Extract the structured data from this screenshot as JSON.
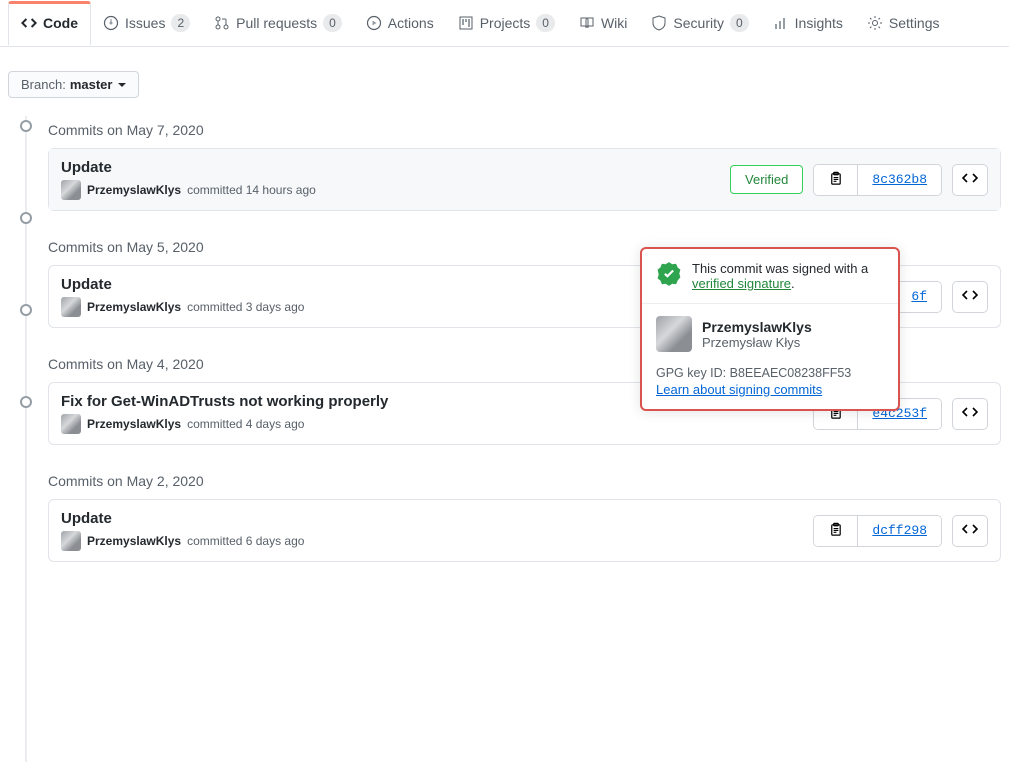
{
  "tabs": [
    {
      "label": "Code",
      "count": null,
      "selected": true,
      "name": "tab-code",
      "icon": "code-icon"
    },
    {
      "label": "Issues",
      "count": "2",
      "selected": false,
      "name": "tab-issues",
      "icon": "issue-icon"
    },
    {
      "label": "Pull requests",
      "count": "0",
      "selected": false,
      "name": "tab-pulls",
      "icon": "pull-request-icon"
    },
    {
      "label": "Actions",
      "count": null,
      "selected": false,
      "name": "tab-actions",
      "icon": "play-icon"
    },
    {
      "label": "Projects",
      "count": "0",
      "selected": false,
      "name": "tab-projects",
      "icon": "project-icon"
    },
    {
      "label": "Wiki",
      "count": null,
      "selected": false,
      "name": "tab-wiki",
      "icon": "book-icon"
    },
    {
      "label": "Security",
      "count": "0",
      "selected": false,
      "name": "tab-security",
      "icon": "shield-icon"
    },
    {
      "label": "Insights",
      "count": null,
      "selected": false,
      "name": "tab-insights",
      "icon": "graph-icon"
    },
    {
      "label": "Settings",
      "count": null,
      "selected": false,
      "name": "tab-settings",
      "icon": "gear-icon"
    }
  ],
  "branch": {
    "label": "Branch:",
    "name": "master"
  },
  "groups": [
    {
      "title": "Commits on May 7, 2020",
      "commits": [
        {
          "title": "Update",
          "author": "PrzemyslawKlys",
          "when": "committed 14 hours ago",
          "sha": "8c362b8",
          "verified": true,
          "highlight": true
        }
      ]
    },
    {
      "title": "Commits on May 5, 2020",
      "commits": [
        {
          "title": "Update",
          "author": "PrzemyslawKlys",
          "when": "committed 3 days ago",
          "sha": "6f",
          "verified": false,
          "highlight": false
        }
      ]
    },
    {
      "title": "Commits on May 4, 2020",
      "commits": [
        {
          "title": "Fix for Get-WinADTrusts not working properly",
          "author": "PrzemyslawKlys",
          "when": "committed 4 days ago",
          "sha": "e4c253f",
          "verified": false,
          "highlight": false
        }
      ]
    },
    {
      "title": "Commits on May 2, 2020",
      "commits": [
        {
          "title": "Update",
          "author": "PrzemyslawKlys",
          "when": "committed 6 days ago",
          "sha": "dcff298",
          "verified": false,
          "highlight": false
        }
      ]
    }
  ],
  "verified_label": "Verified",
  "popover": {
    "line1": "This commit was signed with a",
    "verified_signature": "verified signature",
    "period": ".",
    "username": "PrzemyslawKlys",
    "realname": "Przemysław Kłys",
    "gpg_label": "GPG key ID:",
    "gpg_id": "B8EEAEC08238FF53",
    "learn": "Learn about signing commits"
  }
}
